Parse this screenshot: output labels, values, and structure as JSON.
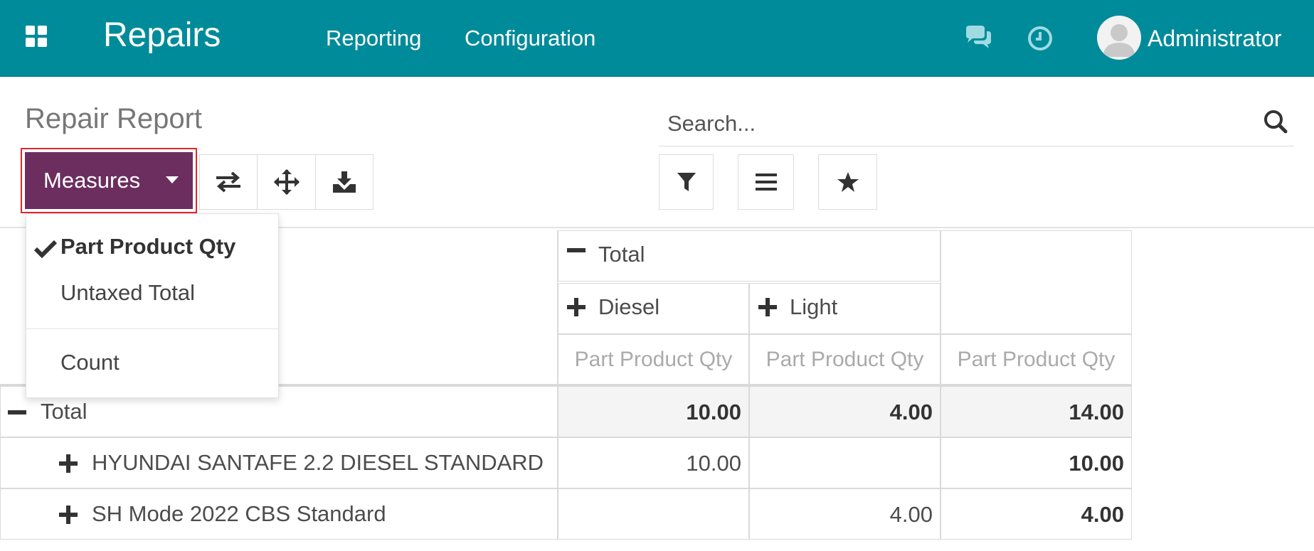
{
  "navbar": {
    "app_title": "Repairs",
    "menus": [
      "Reporting",
      "Configuration"
    ],
    "user_name": "Administrator",
    "icons": [
      "apps-grid-icon",
      "chat-icon",
      "clock-icon"
    ]
  },
  "control_panel": {
    "title": "Repair Report",
    "search_placeholder": "Search...",
    "measures_label": "Measures",
    "tools": [
      "flip-axis-icon",
      "expand-all-icon",
      "download-icon"
    ],
    "search_tools": [
      "filter-icon",
      "group-by-icon",
      "favorite-star-icon"
    ]
  },
  "measures_menu": {
    "items": [
      {
        "label": "Part Product Qty",
        "checked": true
      },
      {
        "label": "Untaxed Total",
        "checked": false
      },
      {
        "label": "Count",
        "checked": false
      }
    ]
  },
  "pivot": {
    "col_header_total": "Total",
    "col_groups": [
      "Diesel",
      "Light"
    ],
    "measure_label": "Part Product Qty",
    "rows": [
      {
        "label": "Total",
        "values": [
          "10.00",
          "4.00",
          "14.00"
        ]
      },
      {
        "label": "HYUNDAI SANTAFE 2.2 DIESEL STANDARD",
        "values": [
          "10.00",
          "",
          "10.00"
        ]
      },
      {
        "label": "SH Mode 2022 CBS Standard",
        "values": [
          "",
          "4.00",
          "4.00"
        ]
      }
    ]
  },
  "colors": {
    "navbar": "#008b9a",
    "primary_button": "#6b2e5f",
    "highlight_border": "#e5262e"
  }
}
